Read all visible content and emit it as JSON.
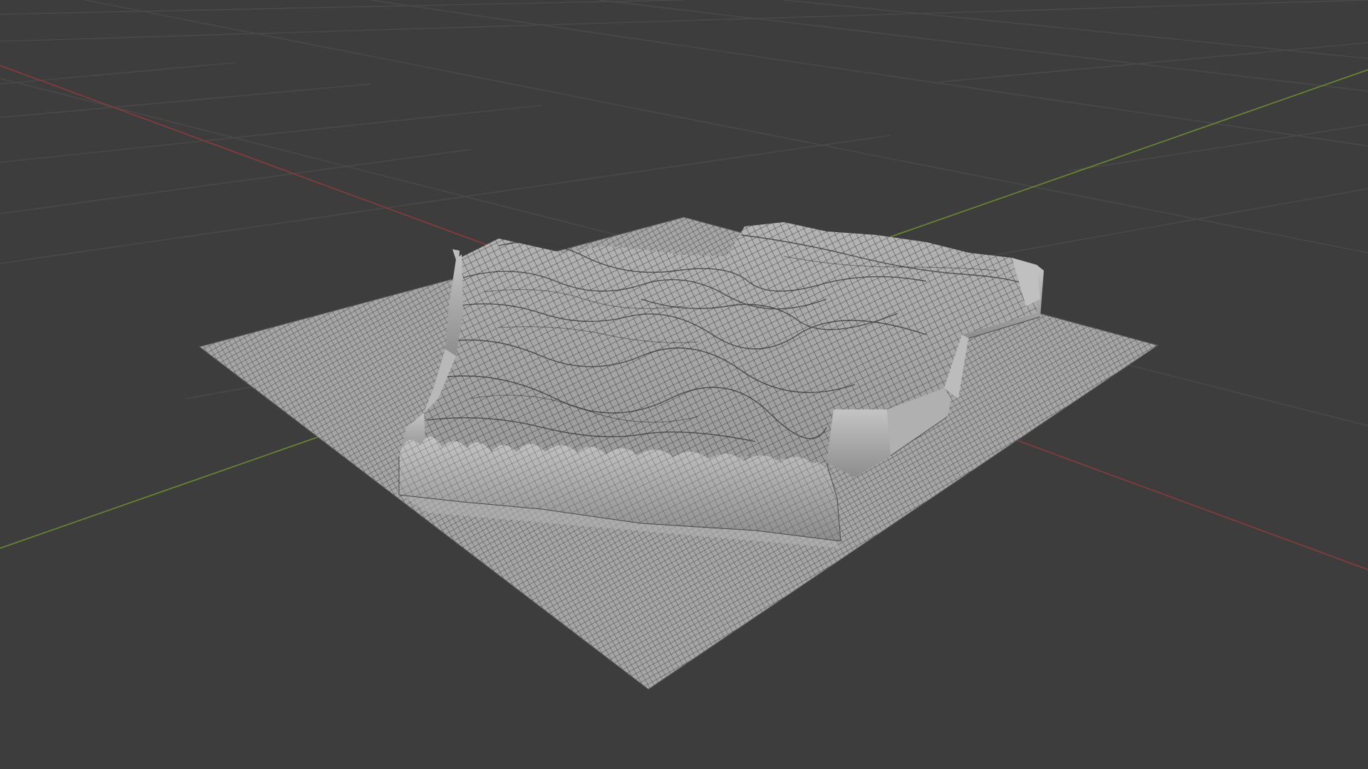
{
  "viewport": {
    "background_color": "#3d3d3d",
    "grid_color": "#4b4b4b",
    "x_axis_color": "#8b3a3a",
    "y_axis_color": "#6b8a2e",
    "mesh_fill_color": "#a9a9a9",
    "mesh_wire_color": "#2c2c2c",
    "object": "terrain-heightmap-mesh",
    "shading_mode": "solid",
    "overlays": [
      "grid-floor",
      "x-axis-line",
      "y-axis-line",
      "wireframe"
    ]
  }
}
